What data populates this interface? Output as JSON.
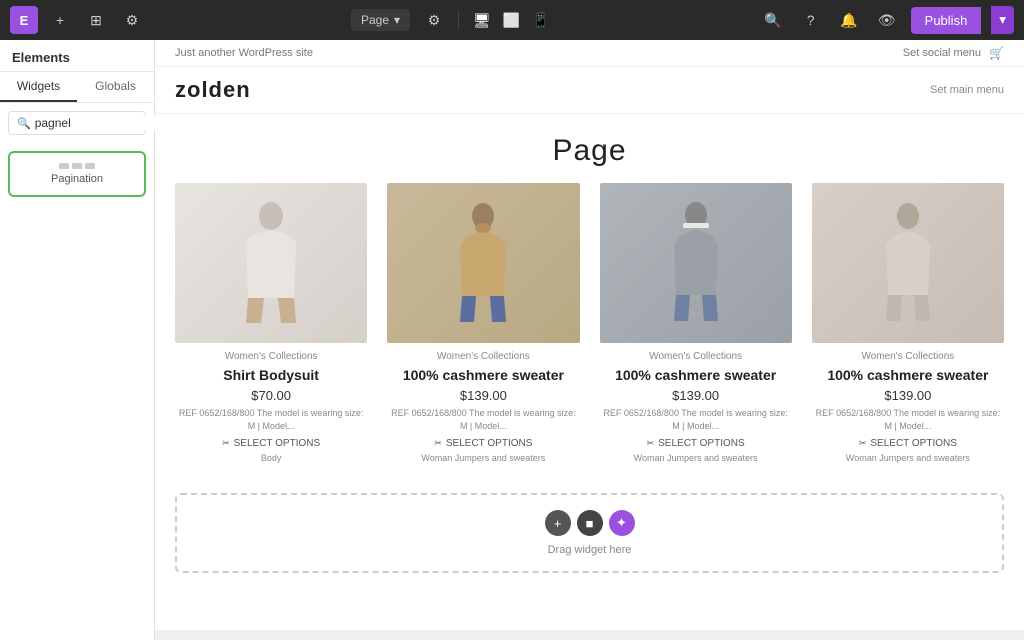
{
  "topbar": {
    "logo_label": "E",
    "page_label": "Page",
    "publish_label": "Publish"
  },
  "sidebar": {
    "title": "Elements",
    "tabs": [
      {
        "id": "widgets",
        "label": "Widgets"
      },
      {
        "id": "globals",
        "label": "Globals"
      }
    ],
    "search_placeholder": "pagnel",
    "search_value": "pagnel",
    "widget": {
      "label": "Pagination"
    }
  },
  "site": {
    "topbar_text": "Just another WordPress site",
    "social_label": "Set social menu",
    "cart_icon": "🛒",
    "logo": "zolden",
    "menu_label": "Set main menu",
    "page_title": "Page",
    "products": [
      {
        "category": "Women's Collections",
        "name": "Shirt Bodysuit",
        "price": "$70.00",
        "description": "REF 0652/168/800 The model is wearing size: M | Model...",
        "cta": "SELECT OPTIONS",
        "tag": "Body",
        "img_class": "img-1"
      },
      {
        "category": "Women's Collections",
        "name": "100% cashmere sweater",
        "price": "$139.00",
        "description": "REF 0652/168/800 The model is wearing size: M | Model...",
        "cta": "SELECT OPTIONS",
        "tag": "Woman Jumpers and sweaters",
        "img_class": "img-2"
      },
      {
        "category": "Women's Collections",
        "name": "100% cashmere sweater",
        "price": "$139.00",
        "description": "REF 0652/168/800 The model is wearing size: M | Model...",
        "cta": "SELECT OPTIONS",
        "tag": "Woman Jumpers and sweaters",
        "img_class": "img-3"
      },
      {
        "category": "Women's Collections",
        "name": "100% cashmere sweater",
        "price": "$139.00",
        "description": "REF 0652/168/800 The model is wearing size: M | Model...",
        "cta": "SELECT OPTIONS",
        "tag": "Woman Jumpers and sweaters",
        "img_class": "img-4"
      }
    ],
    "drop_zone_label": "Drag widget here"
  },
  "icons": {
    "plus": "+",
    "square": "■",
    "asterisk": "✦",
    "search": "🔍",
    "settings": "⚙",
    "eye": "👁",
    "responsive_desktop": "🖥",
    "responsive_tablet": "📱",
    "responsive_mobile": "📲",
    "chevron_down": "▾",
    "clear": "✕"
  }
}
